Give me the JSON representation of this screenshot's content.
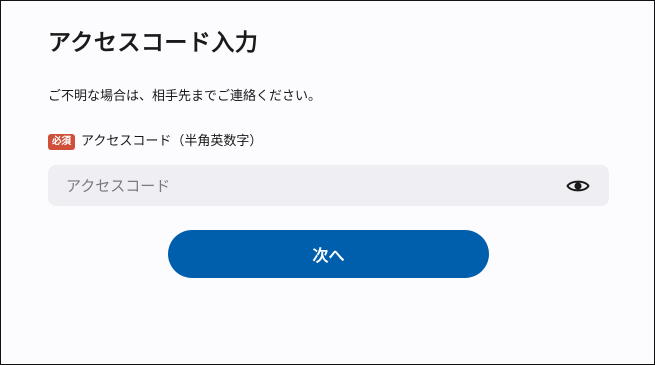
{
  "page": {
    "title": "アクセスコード入力",
    "description": "ご不明な場合は、相手先までご連絡ください。"
  },
  "access_code_field": {
    "required_badge": "必須",
    "label": "アクセスコード（半角英数字）",
    "placeholder": "アクセスコード",
    "value": "",
    "toggle_icon": "eye-icon"
  },
  "actions": {
    "next_label": "次へ"
  },
  "colors": {
    "primary_button": "#005fad",
    "required_badge": "#cf4f3b",
    "input_background": "#efeef3"
  }
}
